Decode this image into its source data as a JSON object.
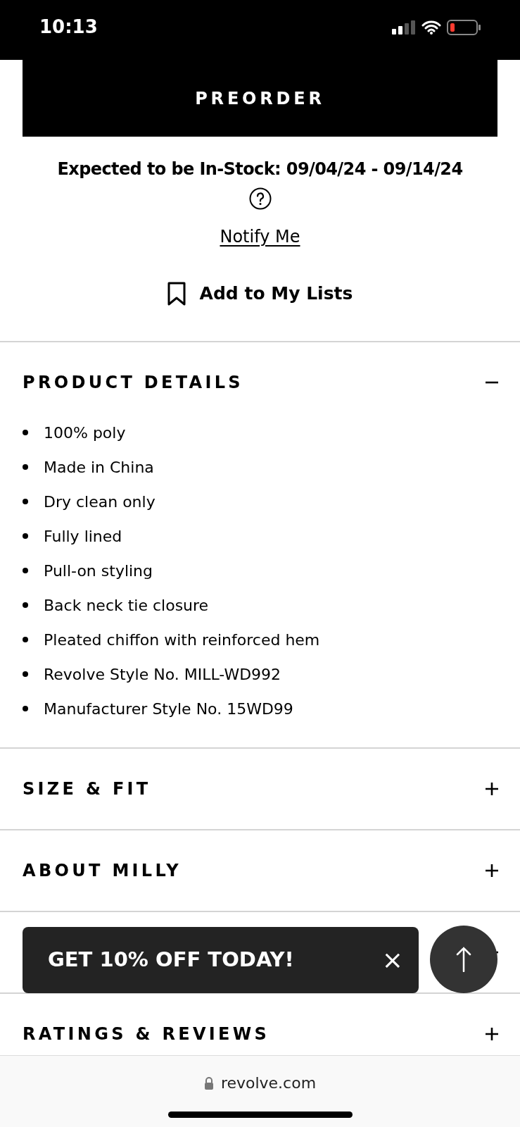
{
  "status_bar": {
    "time": "10:13"
  },
  "preorder_button": "PREORDER",
  "stock_note": "Expected to be In-Stock: 09/04/24 - 09/14/24",
  "notify_link": "Notify Me",
  "add_to_lists": "Add to My Lists",
  "sections": [
    {
      "title": "PRODUCT DETAILS",
      "expanded": true,
      "items": [
        "100% poly",
        "Made in China",
        "Dry clean only",
        "Fully lined",
        "Pull-on styling",
        "Back neck tie closure",
        "Pleated chiffon with reinforced hem",
        "Revolve Style No. MILL-WD992",
        "Manufacturer Style No. 15WD99"
      ]
    },
    {
      "title": "SIZE & FIT",
      "expanded": false
    },
    {
      "title": "ABOUT MILLY",
      "expanded": false
    },
    {
      "expanded": false
    },
    {
      "title": "RATINGS & REVIEWS",
      "expanded": false
    }
  ],
  "promo": {
    "text": "GET 10% OFF TODAY!",
    "close": "×"
  },
  "browser_bar": {
    "url": "revolve.com"
  }
}
